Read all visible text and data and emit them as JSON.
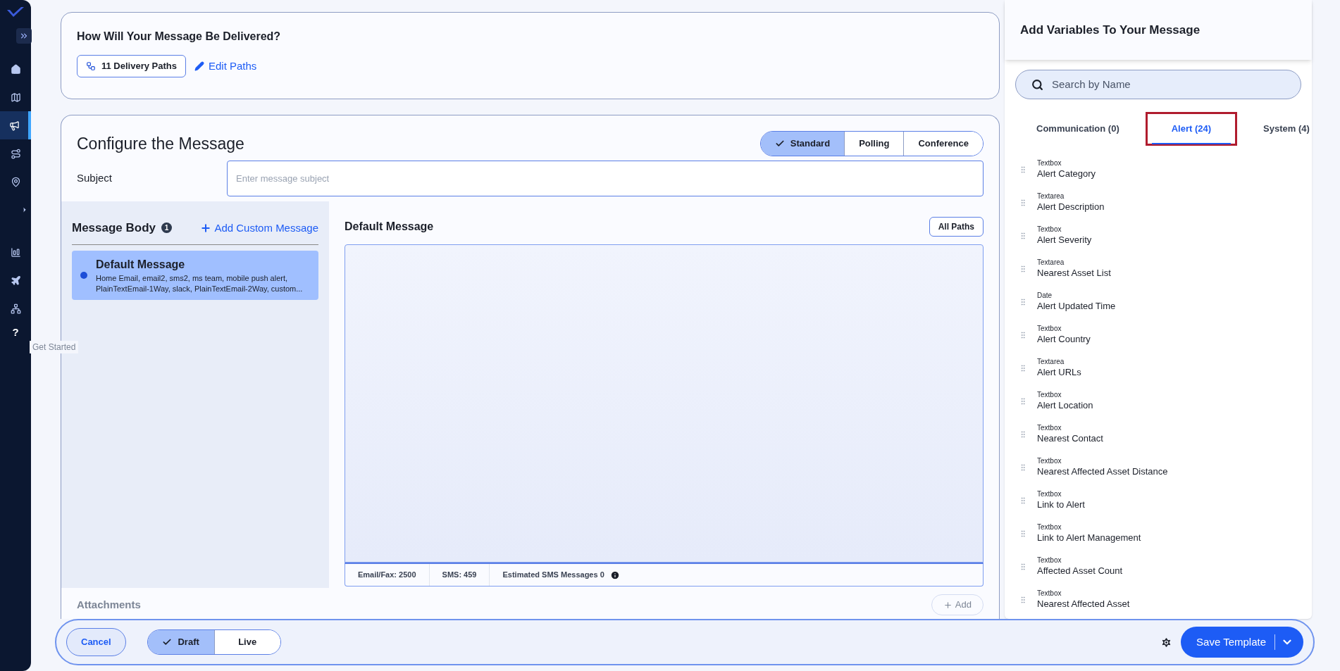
{
  "sidebar": {
    "items": [
      {
        "selected": false
      },
      {
        "selected": false
      },
      {
        "selected": true
      },
      {
        "selected": false
      },
      {
        "selected": false
      },
      {
        "selected": false
      },
      {
        "selected": false
      },
      {
        "selected": false
      },
      {
        "selected": false
      }
    ],
    "help_label": "?",
    "tooltip": "Get Started"
  },
  "delivery": {
    "title": "How Will Your Message Be Delivered?",
    "paths_button": "11 Delivery Paths",
    "edit_link": "Edit Paths"
  },
  "configure": {
    "title": "Configure the Message",
    "modes": [
      {
        "label": "Standard",
        "selected": true
      },
      {
        "label": "Polling",
        "selected": false
      },
      {
        "label": "Conference",
        "selected": false
      }
    ],
    "subject_label": "Subject",
    "subject_placeholder": "Enter message subject",
    "body_title": "Message Body",
    "body_count": "1",
    "add_custom": "Add Custom Message",
    "messages": [
      {
        "title": "Default Message",
        "paths": "Home Email, email2, sms2, ms team, mobile push alert, PlainTextEmail-1Way, slack, PlainTextEmail-2Way, custom...",
        "selected": true
      }
    ],
    "editor_title": "Default Message",
    "all_paths": "All Paths",
    "counters": [
      "Email/Fax: 2500",
      "SMS: 459",
      "Estimated SMS Messages 0"
    ],
    "attachments_label": "Attachments",
    "add_button": "Add"
  },
  "variables": {
    "title": "Add Variables To Your Message",
    "search_placeholder": "Search by Name",
    "tabs": [
      {
        "label": "Communication (0)",
        "selected": false,
        "highlighted": false
      },
      {
        "label": "Alert (24)",
        "selected": true,
        "highlighted": true
      },
      {
        "label": "System (4)",
        "selected": false,
        "highlighted": false
      }
    ],
    "items": [
      {
        "type": "Textbox",
        "name": "Alert Category"
      },
      {
        "type": "Textarea",
        "name": "Alert Description"
      },
      {
        "type": "Textbox",
        "name": "Alert Severity"
      },
      {
        "type": "Textarea",
        "name": "Nearest Asset List"
      },
      {
        "type": "Date",
        "name": "Alert Updated Time"
      },
      {
        "type": "Textbox",
        "name": "Alert Country"
      },
      {
        "type": "Textarea",
        "name": "Alert URLs"
      },
      {
        "type": "Textbox",
        "name": "Alert Location"
      },
      {
        "type": "Textbox",
        "name": "Nearest Contact"
      },
      {
        "type": "Textbox",
        "name": "Nearest Affected Asset Distance"
      },
      {
        "type": "Textbox",
        "name": "Link to Alert"
      },
      {
        "type": "Textbox",
        "name": "Link to Alert Management"
      },
      {
        "type": "Textbox",
        "name": "Affected Asset Count"
      },
      {
        "type": "Textbox",
        "name": "Nearest Affected Asset"
      }
    ]
  },
  "footer": {
    "cancel": "Cancel",
    "states": [
      {
        "label": "Draft",
        "selected": true
      },
      {
        "label": "Live",
        "selected": false
      }
    ],
    "save": "Save Template"
  }
}
